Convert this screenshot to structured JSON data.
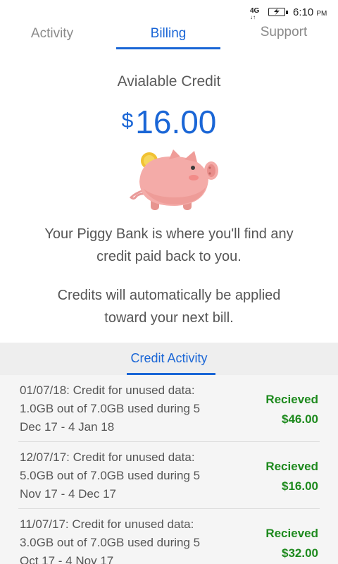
{
  "status_bar": {
    "network": "4G",
    "time": "6:10",
    "ampm": "PM"
  },
  "tabs": [
    {
      "label": "Activity"
    },
    {
      "label": "Billing"
    },
    {
      "label": "Support"
    }
  ],
  "credit": {
    "title": "Avialable Credit",
    "currency": "$",
    "amount": "16.00"
  },
  "description": {
    "line1a": "Your Piggy Bank is where you'll find any",
    "line1b": "credit paid back to you.",
    "line2a": "Credits will automatically be applied",
    "line2b": "toward your next bill."
  },
  "credit_activity": {
    "header": "Credit Activity",
    "items": [
      {
        "line1": "01/07/18: Credit for unused data:",
        "line2": "1.0GB out of 7.0GB used during 5",
        "line3": "Dec 17 - 4 Jan 18",
        "status": "Recieved",
        "amount": "$46.00"
      },
      {
        "line1": "12/07/17: Credit for unused data:",
        "line2": "5.0GB out of 7.0GB used during 5",
        "line3": "Nov 17 - 4 Dec 17",
        "status": "Recieved",
        "amount": "$16.00"
      },
      {
        "line1": "11/07/17: Credit for unused data:",
        "line2": "3.0GB out of 7.0GB used during 5",
        "line3": "Oct 17 - 4 Nov 17",
        "status": "Recieved",
        "amount": "$32.00"
      }
    ]
  },
  "colors": {
    "accent": "#1a66d6",
    "received": "#1e8a1e",
    "list_bg": "#f5f5f5"
  }
}
